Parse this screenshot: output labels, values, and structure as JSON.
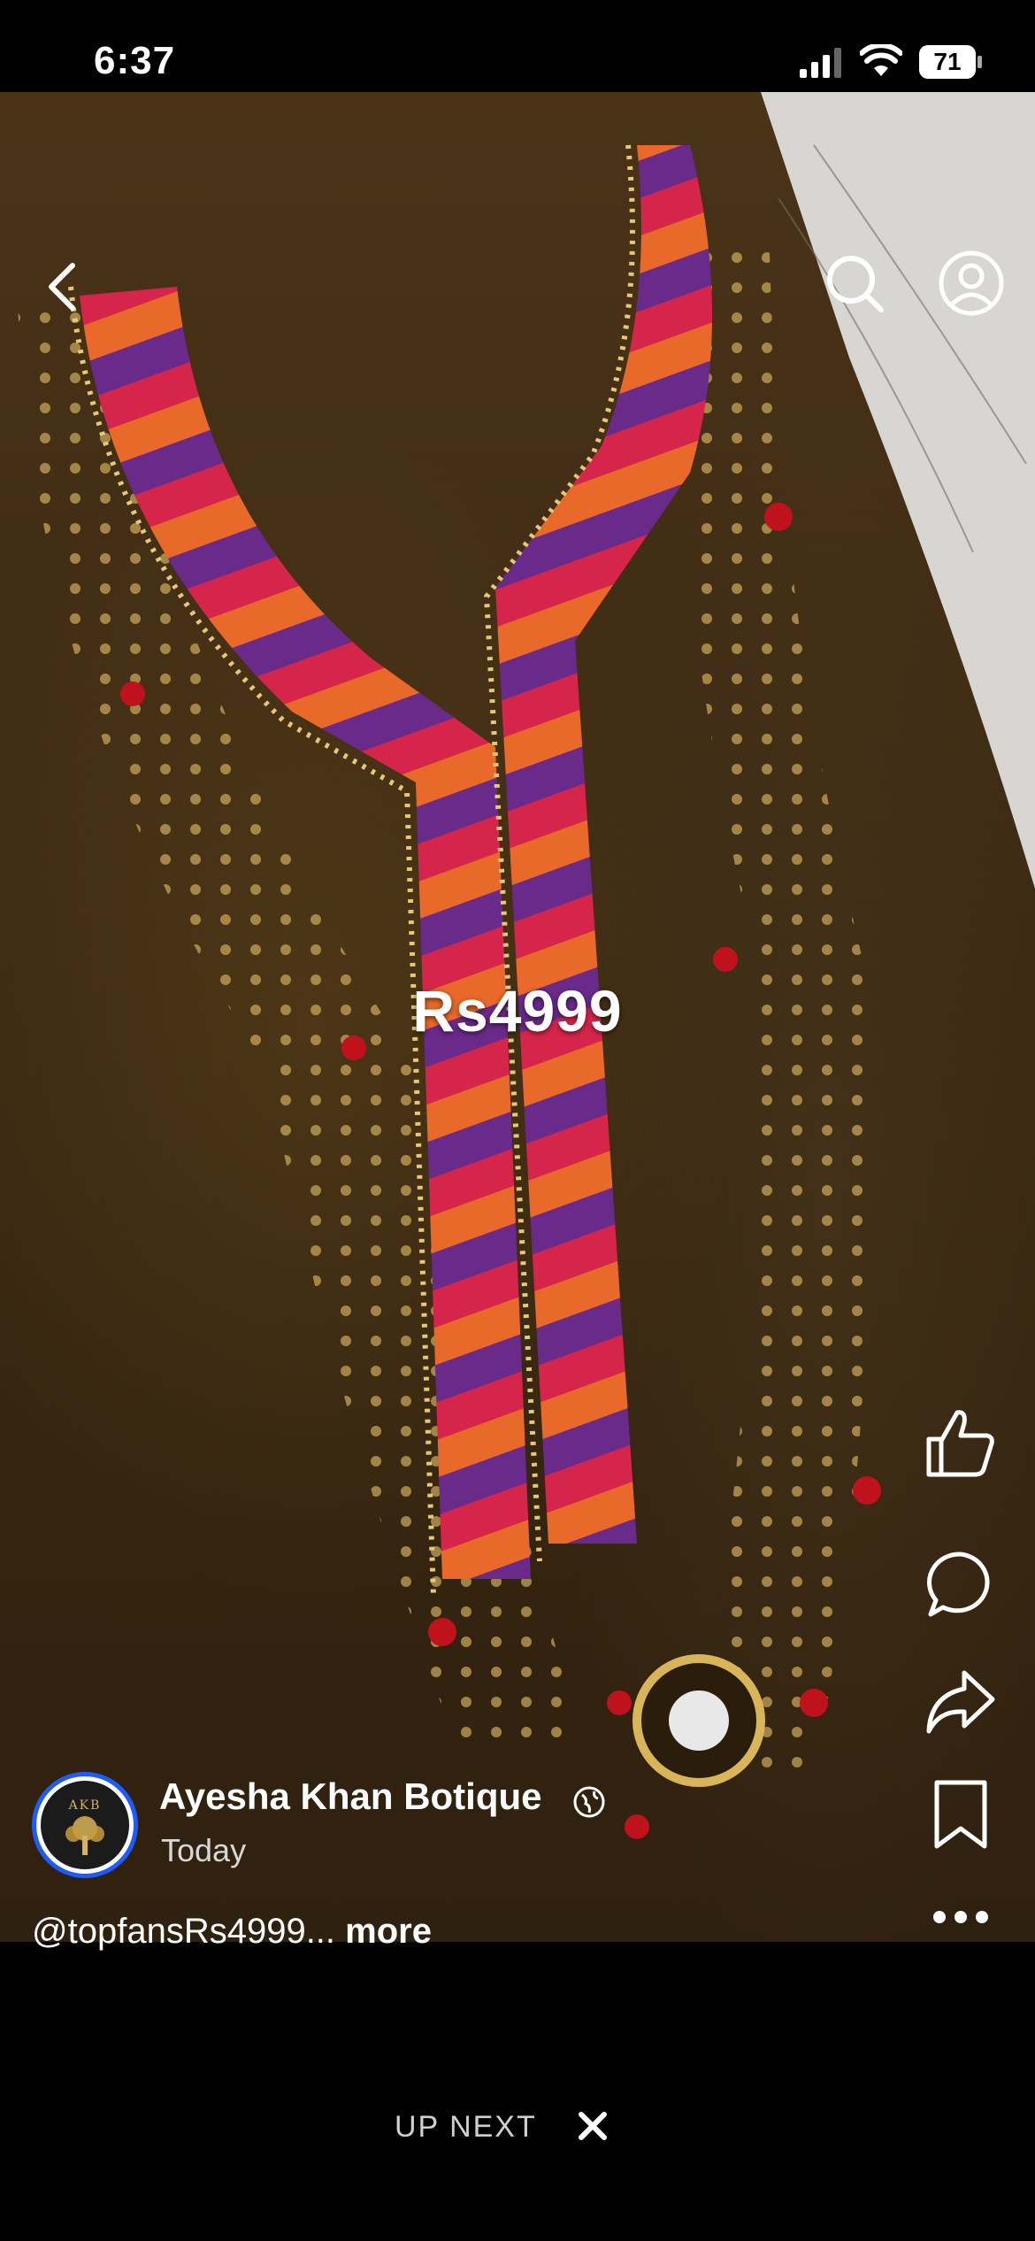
{
  "status_bar": {
    "time": "6:37",
    "battery": "71",
    "icons": [
      "signal-icon",
      "wifi-icon",
      "battery-icon"
    ]
  },
  "header": {
    "icons": [
      "back-chevron-icon",
      "search-icon",
      "profile-icon"
    ]
  },
  "video": {
    "overlay_text": "Rs4999"
  },
  "actions": {
    "icons": [
      "like-icon",
      "comment-icon",
      "share-icon",
      "save-bookmark-icon",
      "more-options-icon"
    ]
  },
  "post": {
    "avatar_text": "AKB",
    "page_name": "Ayesha Khan Botique",
    "date": "Today",
    "caption": "@topfansRs4999...",
    "more_label": "more",
    "privacy_icon": "globe-icon"
  },
  "up_next": {
    "label": "UP NEXT",
    "close_icon": "close-icon"
  },
  "colors": {
    "background": "#000000",
    "avatar_ring": "#1e5bff",
    "fabric": "#3a2812"
  }
}
